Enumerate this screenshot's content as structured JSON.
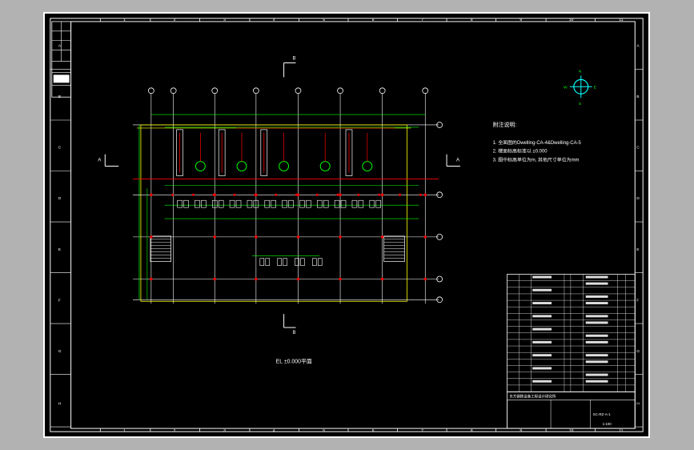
{
  "colors": {
    "background_gutter": "#b2b2b2",
    "sheet": "#000000",
    "frame": "#ffffff",
    "grid_axis": "#ffffff",
    "structure": "#ffff00",
    "dimension": "#00ff00",
    "equipment": "#ff0000",
    "cyan": "#00ffff",
    "marker": "#ff0000"
  },
  "border": {
    "cols": [
      "1",
      "2",
      "3",
      "4",
      "5",
      "6",
      "7",
      "8",
      "9",
      "10",
      "11",
      "12"
    ],
    "rows": [
      "A",
      "B",
      "C",
      "D",
      "E",
      "F",
      "G",
      "H"
    ]
  },
  "drawing": {
    "title": "EL ±0.000平面",
    "section_B": "B",
    "section_A": "A",
    "row_labels": [
      "C",
      "D",
      "E",
      "F"
    ],
    "compass": {
      "n": "N",
      "s": "S",
      "e": "E",
      "w": "W"
    }
  },
  "notes": {
    "heading": "附注说明:",
    "items": [
      "1. 全面图的Dwelling-CA-4&Dwelling-CA-5",
      "2. 楼面标高标准以 ±0.000",
      "3. 图中标高单位为m, 其他尺寸单位为mm"
    ]
  },
  "title_block": {
    "project": "东方钢铁设备工程设计研究所",
    "drawing_no": "SC-RZ-A-1",
    "scale": "1:100"
  }
}
